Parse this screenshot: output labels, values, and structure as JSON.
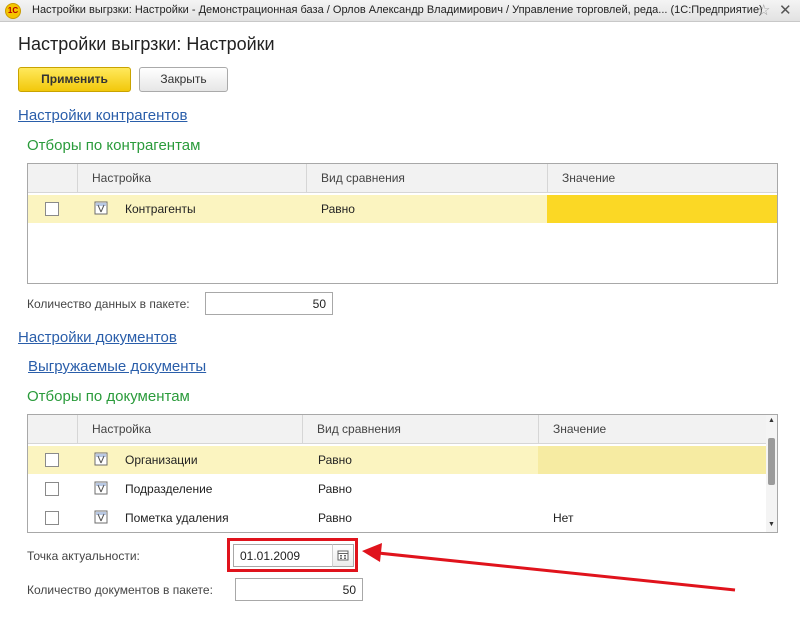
{
  "window": {
    "title": "Настройки выгрзки: Настройки - Демонстрационная база / Орлов Александр Владимирович / Управление торговлей, реда...  (1С:Предприятие)",
    "logo_text": "1C"
  },
  "form": {
    "title": "Настройки выгрзки: Настройки"
  },
  "toolbar": {
    "apply_label": "Применить",
    "close_label": "Закрыть"
  },
  "counterparty_section": {
    "title": "Настройки контрагентов",
    "filters_title": "Отборы по контрагентам",
    "table": {
      "columns": [
        "Настройка",
        "Вид сравнения",
        "Значение"
      ],
      "rows": [
        {
          "setting": "Контрагенты",
          "comparison": "Равно",
          "value": "",
          "checked": false
        }
      ]
    },
    "batch_label": "Количество данных в пакете:",
    "batch_value": "50"
  },
  "documents_section": {
    "title": "Настройки документов",
    "exported_link": "Выгружаемые документы",
    "filters_title": "Отборы по документам",
    "table": {
      "columns": [
        "Настройка",
        "Вид сравнения",
        "Значение"
      ],
      "rows": [
        {
          "setting": "Организации",
          "comparison": "Равно",
          "value": "",
          "checked": false
        },
        {
          "setting": "Подразделение",
          "comparison": "Равно",
          "value": "",
          "checked": false
        },
        {
          "setting": "Пометка удаления",
          "comparison": "Равно",
          "value": "Нет",
          "checked": false
        }
      ]
    },
    "actuality_label": "Точка актуальности:",
    "actuality_value": "01.01.2009",
    "batch_label": "Количество документов в пакете:",
    "batch_value": "50"
  },
  "colors": {
    "accent_yellow": "#f2c80b",
    "link_blue": "#2a5eaa",
    "group_green": "#2a9b3b",
    "annotation_red": "#e0131c"
  },
  "icons": {
    "row_icon": "filter-setting-icon",
    "calendar": "calendar-icon",
    "close": "close-icon",
    "favorite": "star-icon"
  }
}
